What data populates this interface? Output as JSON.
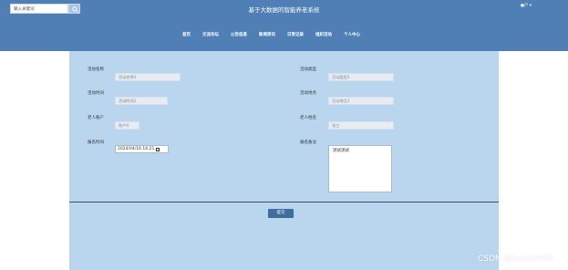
{
  "header": {
    "search_placeholder": "输入关键词",
    "title": "基于大数据的智能养老系统",
    "user_label": "●户 ▾"
  },
  "nav": {
    "items": [
      "首页",
      "交流论坛",
      "公告信息",
      "新闻资讯",
      "日常记录",
      "组织活动",
      "个人中心"
    ]
  },
  "form": {
    "activity_name": {
      "label": "活动名称",
      "placeholder": "活动名称1"
    },
    "activity_type": {
      "label": "活动类型",
      "placeholder": "活动类型1"
    },
    "activity_time": {
      "label": "活动时间",
      "placeholder": "活动时间1"
    },
    "activity_location": {
      "label": "活动地点",
      "placeholder": "活动地点1"
    },
    "elder_account": {
      "label": "老人账户",
      "value": "账户4"
    },
    "elder_name": {
      "label": "老人姓名",
      "value": "张三"
    },
    "signup_time": {
      "label": "报名时间",
      "value": "2024/04/16 16:21"
    },
    "signup_note": {
      "label": "报名备注",
      "value": "测试测试"
    },
    "submit_label": "提交"
  },
  "watermark": "CSDN @bysjlw985"
}
